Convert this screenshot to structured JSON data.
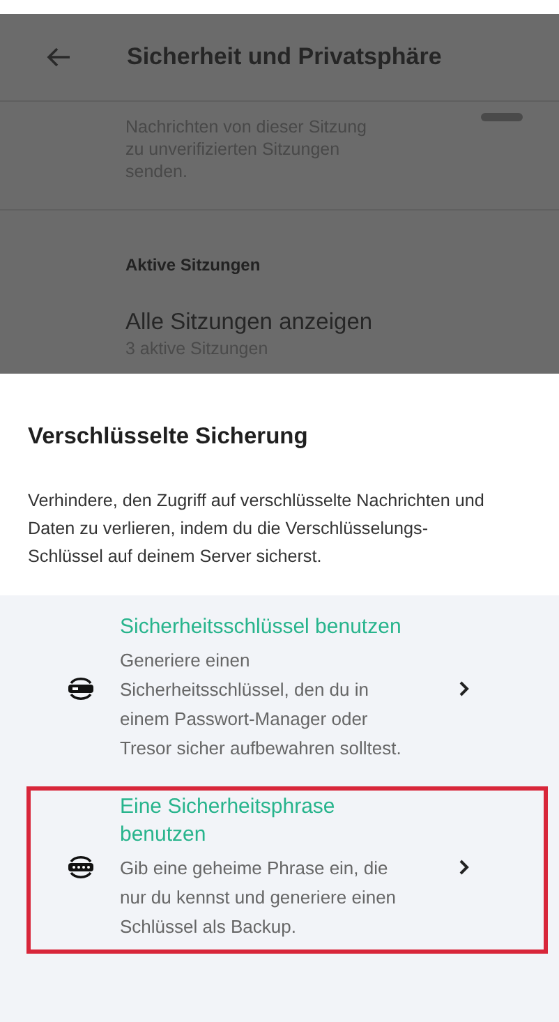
{
  "app_bar": {
    "title": "Sicherheit und Privatsphäre"
  },
  "background": {
    "setting_text": "Nachrichten von dieser Sitzung zu unverifizierten Sitzungen senden.",
    "section_header": "Aktive Sitzungen",
    "sessions_title": "Alle Sitzungen anzeigen",
    "sessions_subtitle": "3 aktive Sitzungen"
  },
  "sheet": {
    "title": "Verschlüsselte Sicherung",
    "description": "Verhindere, den Zugriff auf verschlüsselte Nachrichten und Daten zu verlieren, indem du die Verschlüsselungs-Schlüssel auf deinem Server sicherst.",
    "options": [
      {
        "kind": "key",
        "title": "Sicherheitsschlüssel benutzen",
        "description": "Generiere einen Sicherheitsschlüssel, den du in einem Passwort-Manager oder Tresor sicher aufbewahren solltest.",
        "highlighted": false
      },
      {
        "kind": "phrase",
        "title": "Eine Sicherheitsphrase benutzen",
        "description": "Gib eine geheime Phrase ein, die nur du kennst und generiere einen Schlüssel als Backup.",
        "highlighted": true
      }
    ]
  }
}
